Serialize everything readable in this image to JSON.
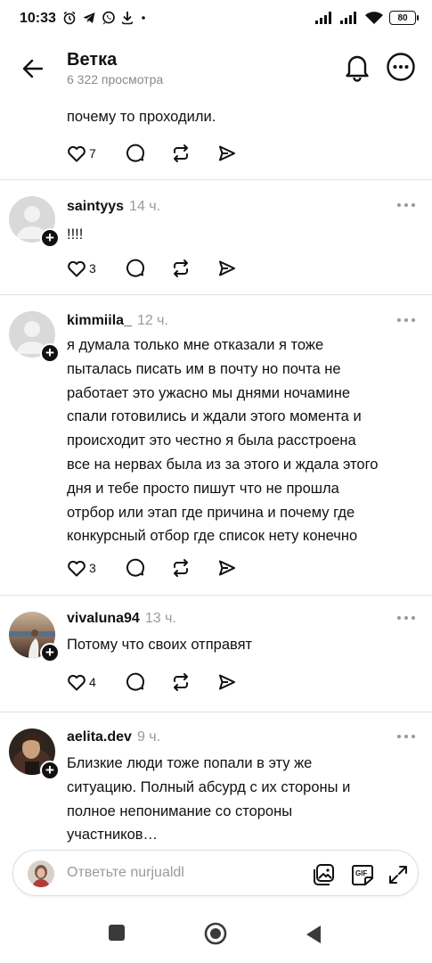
{
  "status_bar": {
    "time": "10:33",
    "battery": "80",
    "left_icons": [
      "alarm-icon",
      "telegram-icon",
      "whatsapp-icon",
      "download-icon",
      "dot-icon"
    ],
    "right_icons": [
      "signal-icon",
      "signal-icon",
      "wifi-icon",
      "battery-icon"
    ]
  },
  "header": {
    "title": "Ветка",
    "subtitle": "6 322 просмотра",
    "icons": [
      "back-arrow-icon",
      "bell-icon",
      "more-circle-icon"
    ]
  },
  "partial_post": {
    "text": "почему то проходили.",
    "likes": "7"
  },
  "posts": [
    {
      "username": "saintyys",
      "time": "14 ч.",
      "text": "!!!!",
      "likes": "3",
      "avatar": "default"
    },
    {
      "username": "kimmiila_",
      "time": "12 ч.",
      "text_lines": [
        "я думала только мне отказали я тоже",
        "пыталась писать им в почту но почта не",
        "работает это ужасно мы днями ночамине",
        "спали готовились и ждали этого момента и",
        "происходит это честно я была расстроена",
        "все на нервах была из за этого и ждала этого",
        "дня и тебе просто пишут что не прошла",
        "отрбор или этап где причина и почему где",
        "конкурсный отбор где список нету конечно"
      ],
      "likes": "3",
      "avatar": "default"
    },
    {
      "username": "vivaluna94",
      "time": "13 ч.",
      "text": "Потому что своих отправят",
      "likes": "4",
      "avatar": "photo"
    },
    {
      "username": "aelita.dev",
      "time": "9 ч.",
      "text_lines": [
        "Близкие люди тоже попали в эту же",
        "ситуацию. Полный абсурд с их стороны и",
        "полное непонимание со стороны",
        "участников…"
      ],
      "avatar": "photo"
    }
  ],
  "reply_bar": {
    "placeholder": "Ответьте nurjualdl",
    "icons": [
      "image-icon",
      "gif-icon",
      "expand-icon"
    ]
  },
  "nav_bar": {
    "icons": [
      "recents-square-icon",
      "home-circle-icon",
      "back-triangle-icon"
    ]
  },
  "colors": {
    "text": "#111111",
    "muted": "#9a9a9a",
    "divider": "#e3e3e3",
    "avatar_default": "#d9d9d9"
  }
}
